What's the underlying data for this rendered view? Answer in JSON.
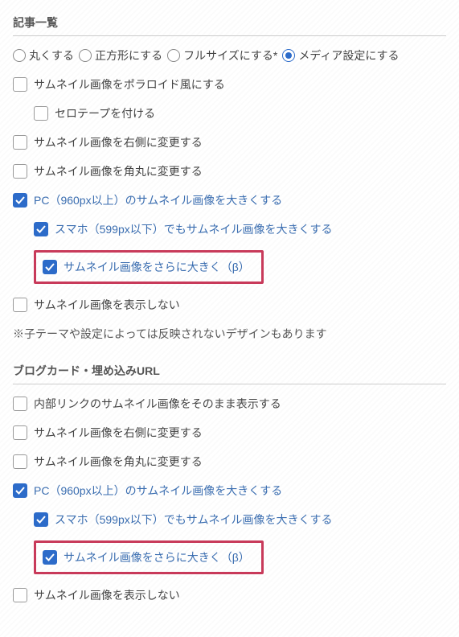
{
  "section1": {
    "title": "記事一覧",
    "radios": [
      {
        "label": "丸くする",
        "checked": false
      },
      {
        "label": "正方形にする",
        "checked": false
      },
      {
        "label": "フルサイズにする*",
        "checked": false
      },
      {
        "label": "メディア設定にする",
        "checked": true
      }
    ],
    "checkboxes": {
      "polaroid": {
        "label": "サムネイル画像をポラロイド風にする",
        "checked": false
      },
      "tape": {
        "label": "セロテープを付ける",
        "checked": false
      },
      "right": {
        "label": "サムネイル画像を右側に変更する",
        "checked": false
      },
      "rounded": {
        "label": "サムネイル画像を角丸に変更する",
        "checked": false
      },
      "pc_large": {
        "label": "PC（960px以上）のサムネイル画像を大きくする",
        "checked": true
      },
      "sp_large": {
        "label": "スマホ（599px以下）でもサムネイル画像を大きくする",
        "checked": true
      },
      "extra_large": {
        "label": "サムネイル画像をさらに大きく（β）",
        "checked": true
      },
      "hide": {
        "label": "サムネイル画像を表示しない",
        "checked": false
      }
    },
    "note": "※子テーマや設定によっては反映されないデザインもあります"
  },
  "section2": {
    "title": "ブログカード・埋め込みURL",
    "checkboxes": {
      "internal": {
        "label": "内部リンクのサムネイル画像をそのまま表示する",
        "checked": false
      },
      "right": {
        "label": "サムネイル画像を右側に変更する",
        "checked": false
      },
      "rounded": {
        "label": "サムネイル画像を角丸に変更する",
        "checked": false
      },
      "pc_large": {
        "label": "PC（960px以上）のサムネイル画像を大きくする",
        "checked": true
      },
      "sp_large": {
        "label": "スマホ（599px以下）でもサムネイル画像を大きくする",
        "checked": true
      },
      "extra_large": {
        "label": "サムネイル画像をさらに大きく（β）",
        "checked": true
      },
      "hide": {
        "label": "サムネイル画像を表示しない",
        "checked": false
      }
    }
  }
}
